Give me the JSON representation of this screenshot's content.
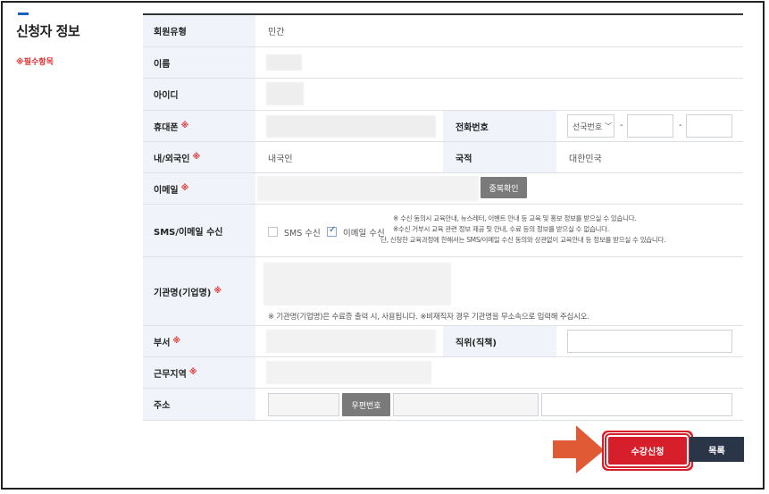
{
  "section": {
    "title": "신청자 정보",
    "required_note": "※필수항목"
  },
  "form": {
    "member_type": {
      "label": "회원유형",
      "value": "민간"
    },
    "name": {
      "label": "이름"
    },
    "user_id": {
      "label": "아이디"
    },
    "mobile": {
      "label": "휴대폰",
      "required_mark": "※"
    },
    "phone": {
      "label": "전화번호",
      "area_select": "선국번호",
      "dash": "-"
    },
    "nationality_type": {
      "label": "내/외국인",
      "required_mark": "※",
      "value": "내국인"
    },
    "nationality": {
      "label": "국적",
      "value": "대한민국"
    },
    "email": {
      "label": "이메일",
      "required_mark": "※",
      "dup_check_button": "중복확인"
    },
    "sms_email": {
      "label": "SMS/이메일 수신",
      "sms_label": "SMS 수신",
      "sms_checked": false,
      "email_label": "이메일 수신",
      "email_checked": true,
      "notes": [
        "※ 수신 동의시 교육안내, 뉴스레터, 이벤트 안내 등 교육 및 홍보 정보를 받으실 수 있습니다.",
        "※수신 거부시 교육 관련 정보 제공 및 안내, 수료 등의 정보를 받으실 수 없습니다.",
        "단, 신청한 교육과정에 한해서는 SMS/이메일 수신 동의와 상관없이 교육안내 등 정보를 받으실 수 있습니다."
      ]
    },
    "org": {
      "label": "기관명(기업명)",
      "required_mark": "※",
      "note": "※ 기관명(기업명)은 수료증 출력 시, 사용됩니다. ※비재직자 경우 기관명을 무소속으로 입력해 주십시오."
    },
    "dept": {
      "label": "부서",
      "required_mark": "※"
    },
    "position": {
      "label": "직위(직책)"
    },
    "region": {
      "label": "근무지역",
      "required_mark": "※"
    },
    "address": {
      "label": "주소",
      "zip_button": "우편번호"
    }
  },
  "actions": {
    "apply": "수강신청",
    "list": "목록"
  },
  "colors": {
    "accent": "#d71f2b",
    "header_bg": "#f0f4fa",
    "list_btn": "#2a3648",
    "arrow": "#e05a35"
  },
  "icons": {
    "dropdown": "chevron-down-icon",
    "checkbox_checked": "check-icon",
    "arrow": "arrow-right-icon"
  }
}
